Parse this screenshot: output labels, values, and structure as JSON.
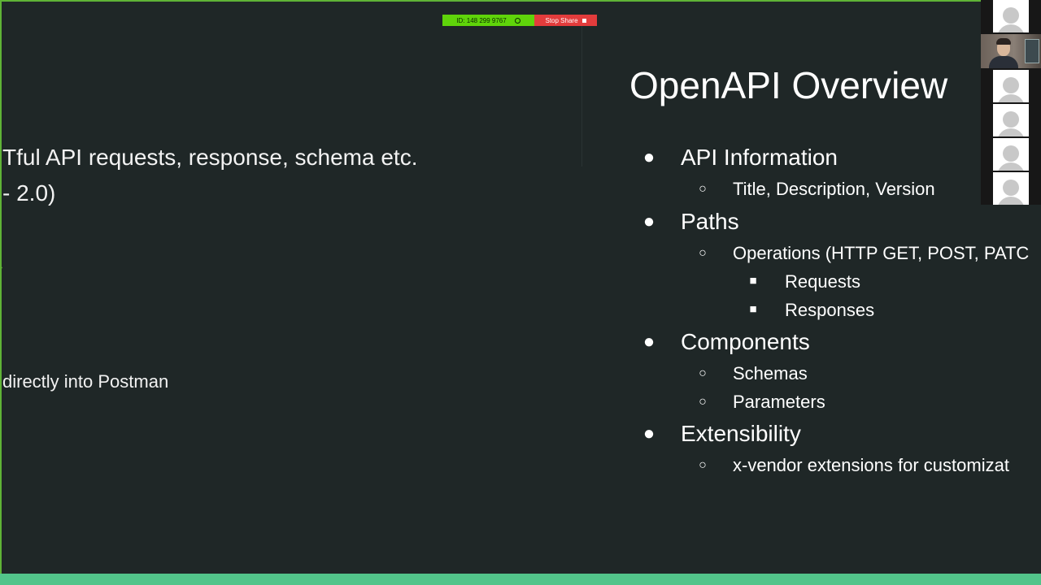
{
  "share_bar": {
    "meeting_id": "ID: 148 299 9767",
    "stop_share_label": "Stop Share"
  },
  "left_slide": {
    "line1": "Tful API requests, response, schema etc.",
    "line2": " - 2.0)",
    "line3": "directly into Postman"
  },
  "slide": {
    "title": "OpenAPI Overview",
    "items": [
      {
        "label": "API Information",
        "children": [
          {
            "label": "Title, Description, Version"
          }
        ]
      },
      {
        "label": "Paths",
        "children": [
          {
            "label": "Operations (HTTP GET, POST, PATC",
            "children": [
              {
                "label": "Requests"
              },
              {
                "label": "Responses"
              }
            ]
          }
        ]
      },
      {
        "label": "Components",
        "children": [
          {
            "label": "Schemas"
          },
          {
            "label": "Parameters"
          }
        ]
      },
      {
        "label": "Extensibility",
        "children": [
          {
            "label": "x-vendor extensions for customizat"
          }
        ]
      }
    ]
  },
  "bullets": {
    "level1": "●",
    "level2": "○",
    "level3": "■"
  },
  "colors": {
    "background": "#1f2727",
    "frame_border": "#5fb336",
    "share_id_bg": "#5fd40a",
    "stop_share_bg": "#e33c3c",
    "bottom_bar": "#52c48a"
  }
}
